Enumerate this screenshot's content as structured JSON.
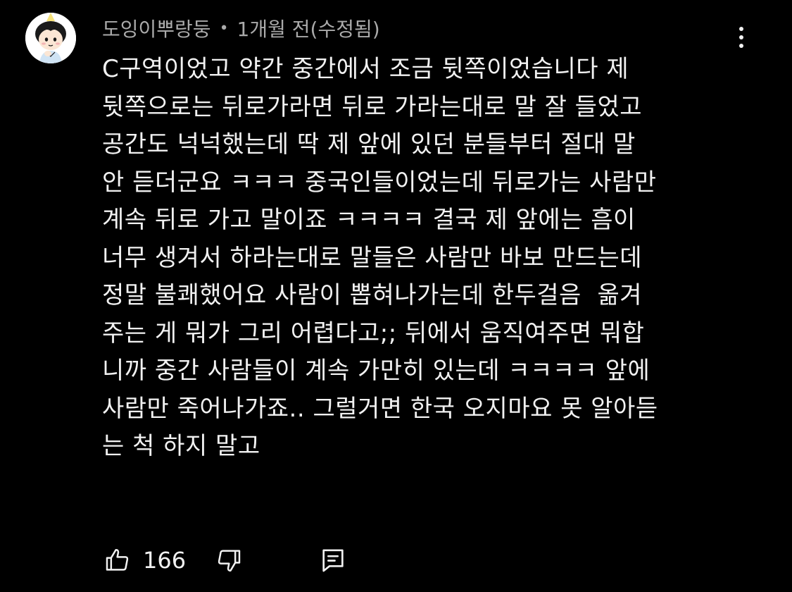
{
  "comment": {
    "author": "도잉이뿌랑둥",
    "separator": "•",
    "timestamp": "1개월 전(수정됨)",
    "text_lines": [
      "C구역이었고 약간 중간에서 조금 뒷쪽이었습니다 제",
      "뒷쪽으로는 뒤로가라면 뒤로 가라는대로 말 잘 들었고",
      "공간도 넉넉했는데 딱 제 앞에 있던 분들부터 절대 말",
      "안 듣더군요 ㅋㅋㅋ 중국인들이었는데 뒤로가는 사람만",
      "계속 뒤로 가고 말이죠 ㅋㅋㅋㅋ 결국 제 앞에는 흠이",
      "너무 생겨서 하라는대로 말들은 사람만 바보 만드는데",
      "정말 불쾌했어요 사람이 뽑혀나가는데 한두걸음  옮겨",
      "주는 게 뭐가 그리 어렵다고;; 뒤에서 움직여주면 뭐합",
      "니까 중간 사람들이 계속 가만히 있는데 ㅋㅋㅋㅋ 앞에",
      "사람만 죽어나가죠.. 그럴거면 한국 오지마요 못 알아듣",
      "는 척 하지 말고"
    ],
    "like_count": "166",
    "icons": {
      "avatar": "avatar-cartoon-boy",
      "more": "vertical-dots-icon",
      "like": "thumbs-up-icon",
      "dislike": "thumbs-down-icon",
      "reply": "reply-comment-icon"
    }
  },
  "colors": {
    "background": "#000000",
    "text": "#f1f1f1",
    "meta": "#aaaaaa"
  }
}
